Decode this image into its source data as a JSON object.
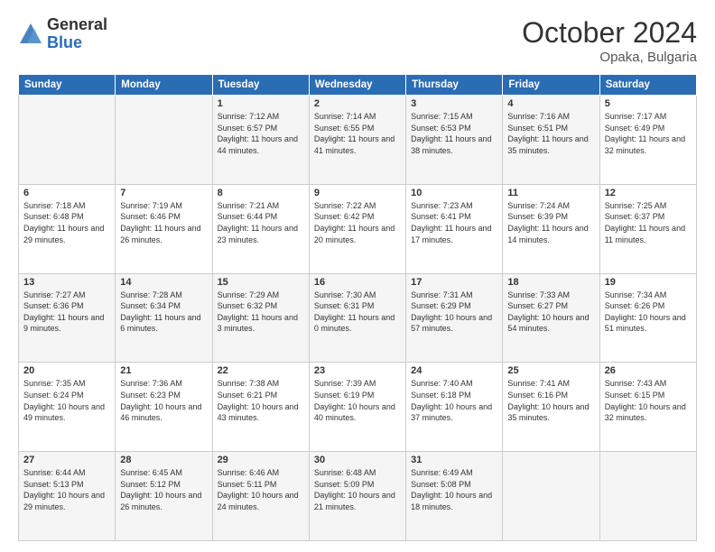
{
  "header": {
    "logo_general": "General",
    "logo_blue": "Blue",
    "month_title": "October 2024",
    "location": "Opaka, Bulgaria"
  },
  "days_of_week": [
    "Sunday",
    "Monday",
    "Tuesday",
    "Wednesday",
    "Thursday",
    "Friday",
    "Saturday"
  ],
  "weeks": [
    [
      {
        "day": "",
        "sunrise": "",
        "sunset": "",
        "daylight": ""
      },
      {
        "day": "",
        "sunrise": "",
        "sunset": "",
        "daylight": ""
      },
      {
        "day": "1",
        "sunrise": "Sunrise: 7:12 AM",
        "sunset": "Sunset: 6:57 PM",
        "daylight": "Daylight: 11 hours and 44 minutes."
      },
      {
        "day": "2",
        "sunrise": "Sunrise: 7:14 AM",
        "sunset": "Sunset: 6:55 PM",
        "daylight": "Daylight: 11 hours and 41 minutes."
      },
      {
        "day": "3",
        "sunrise": "Sunrise: 7:15 AM",
        "sunset": "Sunset: 6:53 PM",
        "daylight": "Daylight: 11 hours and 38 minutes."
      },
      {
        "day": "4",
        "sunrise": "Sunrise: 7:16 AM",
        "sunset": "Sunset: 6:51 PM",
        "daylight": "Daylight: 11 hours and 35 minutes."
      },
      {
        "day": "5",
        "sunrise": "Sunrise: 7:17 AM",
        "sunset": "Sunset: 6:49 PM",
        "daylight": "Daylight: 11 hours and 32 minutes."
      }
    ],
    [
      {
        "day": "6",
        "sunrise": "Sunrise: 7:18 AM",
        "sunset": "Sunset: 6:48 PM",
        "daylight": "Daylight: 11 hours and 29 minutes."
      },
      {
        "day": "7",
        "sunrise": "Sunrise: 7:19 AM",
        "sunset": "Sunset: 6:46 PM",
        "daylight": "Daylight: 11 hours and 26 minutes."
      },
      {
        "day": "8",
        "sunrise": "Sunrise: 7:21 AM",
        "sunset": "Sunset: 6:44 PM",
        "daylight": "Daylight: 11 hours and 23 minutes."
      },
      {
        "day": "9",
        "sunrise": "Sunrise: 7:22 AM",
        "sunset": "Sunset: 6:42 PM",
        "daylight": "Daylight: 11 hours and 20 minutes."
      },
      {
        "day": "10",
        "sunrise": "Sunrise: 7:23 AM",
        "sunset": "Sunset: 6:41 PM",
        "daylight": "Daylight: 11 hours and 17 minutes."
      },
      {
        "day": "11",
        "sunrise": "Sunrise: 7:24 AM",
        "sunset": "Sunset: 6:39 PM",
        "daylight": "Daylight: 11 hours and 14 minutes."
      },
      {
        "day": "12",
        "sunrise": "Sunrise: 7:25 AM",
        "sunset": "Sunset: 6:37 PM",
        "daylight": "Daylight: 11 hours and 11 minutes."
      }
    ],
    [
      {
        "day": "13",
        "sunrise": "Sunrise: 7:27 AM",
        "sunset": "Sunset: 6:36 PM",
        "daylight": "Daylight: 11 hours and 9 minutes."
      },
      {
        "day": "14",
        "sunrise": "Sunrise: 7:28 AM",
        "sunset": "Sunset: 6:34 PM",
        "daylight": "Daylight: 11 hours and 6 minutes."
      },
      {
        "day": "15",
        "sunrise": "Sunrise: 7:29 AM",
        "sunset": "Sunset: 6:32 PM",
        "daylight": "Daylight: 11 hours and 3 minutes."
      },
      {
        "day": "16",
        "sunrise": "Sunrise: 7:30 AM",
        "sunset": "Sunset: 6:31 PM",
        "daylight": "Daylight: 11 hours and 0 minutes."
      },
      {
        "day": "17",
        "sunrise": "Sunrise: 7:31 AM",
        "sunset": "Sunset: 6:29 PM",
        "daylight": "Daylight: 10 hours and 57 minutes."
      },
      {
        "day": "18",
        "sunrise": "Sunrise: 7:33 AM",
        "sunset": "Sunset: 6:27 PM",
        "daylight": "Daylight: 10 hours and 54 minutes."
      },
      {
        "day": "19",
        "sunrise": "Sunrise: 7:34 AM",
        "sunset": "Sunset: 6:26 PM",
        "daylight": "Daylight: 10 hours and 51 minutes."
      }
    ],
    [
      {
        "day": "20",
        "sunrise": "Sunrise: 7:35 AM",
        "sunset": "Sunset: 6:24 PM",
        "daylight": "Daylight: 10 hours and 49 minutes."
      },
      {
        "day": "21",
        "sunrise": "Sunrise: 7:36 AM",
        "sunset": "Sunset: 6:23 PM",
        "daylight": "Daylight: 10 hours and 46 minutes."
      },
      {
        "day": "22",
        "sunrise": "Sunrise: 7:38 AM",
        "sunset": "Sunset: 6:21 PM",
        "daylight": "Daylight: 10 hours and 43 minutes."
      },
      {
        "day": "23",
        "sunrise": "Sunrise: 7:39 AM",
        "sunset": "Sunset: 6:19 PM",
        "daylight": "Daylight: 10 hours and 40 minutes."
      },
      {
        "day": "24",
        "sunrise": "Sunrise: 7:40 AM",
        "sunset": "Sunset: 6:18 PM",
        "daylight": "Daylight: 10 hours and 37 minutes."
      },
      {
        "day": "25",
        "sunrise": "Sunrise: 7:41 AM",
        "sunset": "Sunset: 6:16 PM",
        "daylight": "Daylight: 10 hours and 35 minutes."
      },
      {
        "day": "26",
        "sunrise": "Sunrise: 7:43 AM",
        "sunset": "Sunset: 6:15 PM",
        "daylight": "Daylight: 10 hours and 32 minutes."
      }
    ],
    [
      {
        "day": "27",
        "sunrise": "Sunrise: 6:44 AM",
        "sunset": "Sunset: 5:13 PM",
        "daylight": "Daylight: 10 hours and 29 minutes."
      },
      {
        "day": "28",
        "sunrise": "Sunrise: 6:45 AM",
        "sunset": "Sunset: 5:12 PM",
        "daylight": "Daylight: 10 hours and 26 minutes."
      },
      {
        "day": "29",
        "sunrise": "Sunrise: 6:46 AM",
        "sunset": "Sunset: 5:11 PM",
        "daylight": "Daylight: 10 hours and 24 minutes."
      },
      {
        "day": "30",
        "sunrise": "Sunrise: 6:48 AM",
        "sunset": "Sunset: 5:09 PM",
        "daylight": "Daylight: 10 hours and 21 minutes."
      },
      {
        "day": "31",
        "sunrise": "Sunrise: 6:49 AM",
        "sunset": "Sunset: 5:08 PM",
        "daylight": "Daylight: 10 hours and 18 minutes."
      },
      {
        "day": "",
        "sunrise": "",
        "sunset": "",
        "daylight": ""
      },
      {
        "day": "",
        "sunrise": "",
        "sunset": "",
        "daylight": ""
      }
    ]
  ]
}
